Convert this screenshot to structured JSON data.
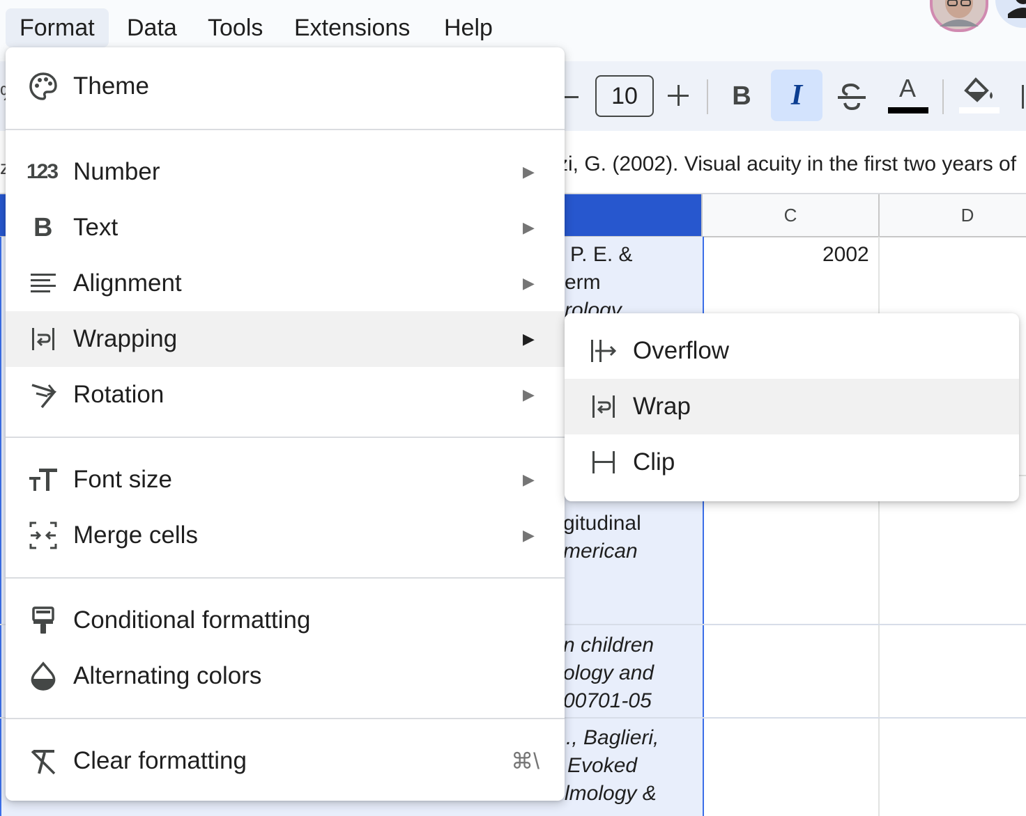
{
  "menubar": {
    "items": [
      {
        "label": "Format",
        "active": true
      },
      {
        "label": "Data"
      },
      {
        "label": "Tools"
      },
      {
        "label": "Extensions"
      },
      {
        "label": "Help"
      }
    ]
  },
  "toolbar": {
    "decrease_icon": "minus-icon",
    "font_size": "10",
    "increase_icon": "plus-icon",
    "bold_icon": "bold-icon",
    "italic_icon": "italic-icon",
    "italic_active": true,
    "strikethrough_icon": "strikethrough-icon",
    "text_color_label": "A",
    "text_color": "#000000",
    "fill_color_icon": "paint-bucket-icon",
    "fill_color": "#ffffff"
  },
  "formula_bar": {
    "text": "zi, G. (2002). Visual acuity in the first two years of"
  },
  "grid": {
    "columns": [
      "C",
      "D"
    ],
    "cells": {
      "b1_line1": "P. E. &",
      "b1_line2": "erm",
      "b1_line3": "rology",
      "c1": "2002",
      "b2_line1": "gitudinal",
      "b2_line2": "merican",
      "b3_line1": "n children",
      "b3_line2": "ology and",
      "b3_line3": "00701-05",
      "b4_line1": "., Baglieri,",
      "b4_line2": "Evoked",
      "b4_line3": "lmology &"
    }
  },
  "format_menu": {
    "items": [
      {
        "label": "Theme",
        "icon": "palette-icon"
      },
      {
        "label": "Number",
        "icon": "number-format-icon",
        "submenu": true
      },
      {
        "label": "Text",
        "icon": "bold-text-icon",
        "submenu": true
      },
      {
        "label": "Alignment",
        "icon": "align-left-icon",
        "submenu": true
      },
      {
        "label": "Wrapping",
        "icon": "wrap-text-icon",
        "submenu": true,
        "highlighted": true
      },
      {
        "label": "Rotation",
        "icon": "text-rotation-icon",
        "submenu": true
      },
      {
        "label": "Font size",
        "icon": "font-size-icon",
        "submenu": true
      },
      {
        "label": "Merge cells",
        "icon": "merge-cells-icon",
        "submenu": true
      },
      {
        "label": "Conditional formatting",
        "icon": "paint-roller-icon"
      },
      {
        "label": "Alternating colors",
        "icon": "droplet-icon"
      },
      {
        "label": "Clear formatting",
        "icon": "clear-format-icon",
        "shortcut": "⌘\\"
      }
    ],
    "submenu_arrow": "▶"
  },
  "wrapping_submenu": {
    "items": [
      {
        "label": "Overflow",
        "icon": "overflow-icon"
      },
      {
        "label": "Wrap",
        "icon": "wrap-icon",
        "highlighted": true
      },
      {
        "label": "Clip",
        "icon": "clip-icon"
      }
    ]
  }
}
